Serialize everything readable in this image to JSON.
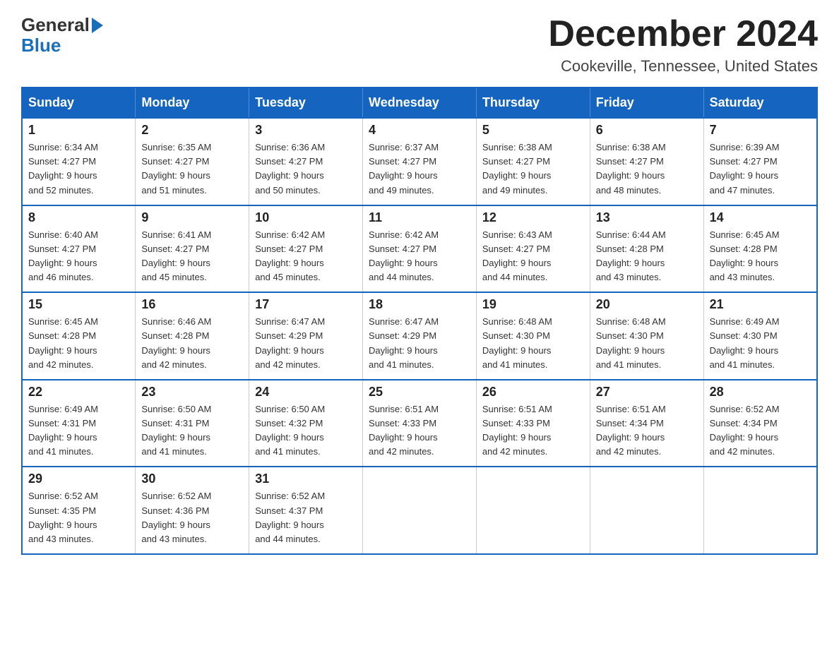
{
  "header": {
    "logo_text1": "General",
    "logo_text2": "Blue",
    "month_title": "December 2024",
    "location": "Cookeville, Tennessee, United States"
  },
  "days_of_week": [
    "Sunday",
    "Monday",
    "Tuesday",
    "Wednesday",
    "Thursday",
    "Friday",
    "Saturday"
  ],
  "weeks": [
    [
      {
        "day": "1",
        "sunrise": "6:34 AM",
        "sunset": "4:27 PM",
        "daylight": "9 hours and 52 minutes."
      },
      {
        "day": "2",
        "sunrise": "6:35 AM",
        "sunset": "4:27 PM",
        "daylight": "9 hours and 51 minutes."
      },
      {
        "day": "3",
        "sunrise": "6:36 AM",
        "sunset": "4:27 PM",
        "daylight": "9 hours and 50 minutes."
      },
      {
        "day": "4",
        "sunrise": "6:37 AM",
        "sunset": "4:27 PM",
        "daylight": "9 hours and 49 minutes."
      },
      {
        "day": "5",
        "sunrise": "6:38 AM",
        "sunset": "4:27 PM",
        "daylight": "9 hours and 49 minutes."
      },
      {
        "day": "6",
        "sunrise": "6:38 AM",
        "sunset": "4:27 PM",
        "daylight": "9 hours and 48 minutes."
      },
      {
        "day": "7",
        "sunrise": "6:39 AM",
        "sunset": "4:27 PM",
        "daylight": "9 hours and 47 minutes."
      }
    ],
    [
      {
        "day": "8",
        "sunrise": "6:40 AM",
        "sunset": "4:27 PM",
        "daylight": "9 hours and 46 minutes."
      },
      {
        "day": "9",
        "sunrise": "6:41 AM",
        "sunset": "4:27 PM",
        "daylight": "9 hours and 45 minutes."
      },
      {
        "day": "10",
        "sunrise": "6:42 AM",
        "sunset": "4:27 PM",
        "daylight": "9 hours and 45 minutes."
      },
      {
        "day": "11",
        "sunrise": "6:42 AM",
        "sunset": "4:27 PM",
        "daylight": "9 hours and 44 minutes."
      },
      {
        "day": "12",
        "sunrise": "6:43 AM",
        "sunset": "4:27 PM",
        "daylight": "9 hours and 44 minutes."
      },
      {
        "day": "13",
        "sunrise": "6:44 AM",
        "sunset": "4:28 PM",
        "daylight": "9 hours and 43 minutes."
      },
      {
        "day": "14",
        "sunrise": "6:45 AM",
        "sunset": "4:28 PM",
        "daylight": "9 hours and 43 minutes."
      }
    ],
    [
      {
        "day": "15",
        "sunrise": "6:45 AM",
        "sunset": "4:28 PM",
        "daylight": "9 hours and 42 minutes."
      },
      {
        "day": "16",
        "sunrise": "6:46 AM",
        "sunset": "4:28 PM",
        "daylight": "9 hours and 42 minutes."
      },
      {
        "day": "17",
        "sunrise": "6:47 AM",
        "sunset": "4:29 PM",
        "daylight": "9 hours and 42 minutes."
      },
      {
        "day": "18",
        "sunrise": "6:47 AM",
        "sunset": "4:29 PM",
        "daylight": "9 hours and 41 minutes."
      },
      {
        "day": "19",
        "sunrise": "6:48 AM",
        "sunset": "4:30 PM",
        "daylight": "9 hours and 41 minutes."
      },
      {
        "day": "20",
        "sunrise": "6:48 AM",
        "sunset": "4:30 PM",
        "daylight": "9 hours and 41 minutes."
      },
      {
        "day": "21",
        "sunrise": "6:49 AM",
        "sunset": "4:30 PM",
        "daylight": "9 hours and 41 minutes."
      }
    ],
    [
      {
        "day": "22",
        "sunrise": "6:49 AM",
        "sunset": "4:31 PM",
        "daylight": "9 hours and 41 minutes."
      },
      {
        "day": "23",
        "sunrise": "6:50 AM",
        "sunset": "4:31 PM",
        "daylight": "9 hours and 41 minutes."
      },
      {
        "day": "24",
        "sunrise": "6:50 AM",
        "sunset": "4:32 PM",
        "daylight": "9 hours and 41 minutes."
      },
      {
        "day": "25",
        "sunrise": "6:51 AM",
        "sunset": "4:33 PM",
        "daylight": "9 hours and 42 minutes."
      },
      {
        "day": "26",
        "sunrise": "6:51 AM",
        "sunset": "4:33 PM",
        "daylight": "9 hours and 42 minutes."
      },
      {
        "day": "27",
        "sunrise": "6:51 AM",
        "sunset": "4:34 PM",
        "daylight": "9 hours and 42 minutes."
      },
      {
        "day": "28",
        "sunrise": "6:52 AM",
        "sunset": "4:34 PM",
        "daylight": "9 hours and 42 minutes."
      }
    ],
    [
      {
        "day": "29",
        "sunrise": "6:52 AM",
        "sunset": "4:35 PM",
        "daylight": "9 hours and 43 minutes."
      },
      {
        "day": "30",
        "sunrise": "6:52 AM",
        "sunset": "4:36 PM",
        "daylight": "9 hours and 43 minutes."
      },
      {
        "day": "31",
        "sunrise": "6:52 AM",
        "sunset": "4:37 PM",
        "daylight": "9 hours and 44 minutes."
      },
      null,
      null,
      null,
      null
    ]
  ],
  "labels": {
    "sunrise": "Sunrise:",
    "sunset": "Sunset:",
    "daylight": "Daylight:"
  }
}
